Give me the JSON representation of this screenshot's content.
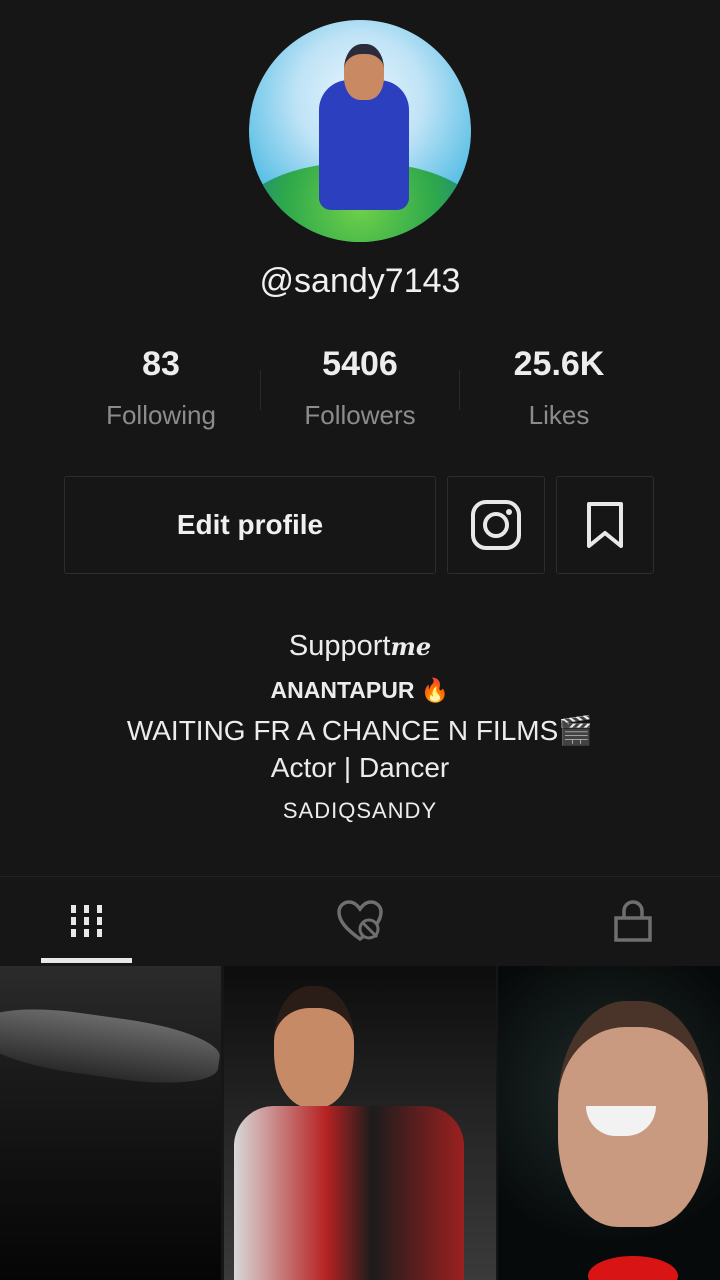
{
  "profile": {
    "username": "@sandy7143",
    "avatar_icon": "profile-photo"
  },
  "stats": [
    {
      "value": "83",
      "label": "Following"
    },
    {
      "value": "5406",
      "label": "Followers"
    },
    {
      "value": "25.6K",
      "label": "Likes"
    }
  ],
  "actions": {
    "edit_label": "Edit profile",
    "instagram_icon": "instagram-icon",
    "bookmark_icon": "bookmark-icon"
  },
  "bio": {
    "line1": "Support",
    "line1_suffix": "me",
    "line2": "ANANTAPUR 🔥",
    "line3": "WAITING FR A CHANCE N FILMS🎬",
    "line4": "Actor | Dancer",
    "line5": "SADIQSANDY"
  },
  "tabs": [
    {
      "name": "videos",
      "icon": "grid-icon",
      "active": true
    },
    {
      "name": "liked",
      "icon": "liked-hidden-icon",
      "active": false
    },
    {
      "name": "private",
      "icon": "lock-icon",
      "active": false
    }
  ],
  "colors": {
    "background": "#161616",
    "muted_text": "#8c8c8c",
    "border": "#2d2d2d"
  }
}
